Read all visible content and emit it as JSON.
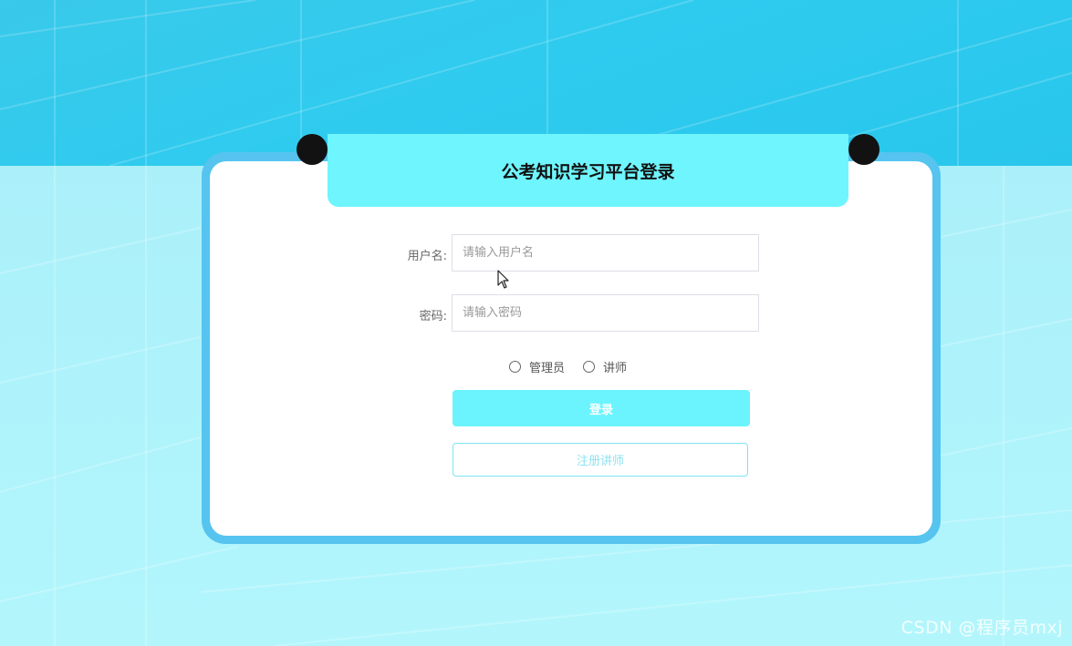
{
  "page": {
    "title": "公考知识学习平台登录",
    "watermark": "CSDN @程序员mxj"
  },
  "form": {
    "username": {
      "label": "用户名:",
      "placeholder": "请输入用户名",
      "value": ""
    },
    "password": {
      "label": "密码:",
      "placeholder": "请输入密码",
      "value": ""
    },
    "roles": [
      {
        "label": "管理员",
        "selected": false
      },
      {
        "label": "讲师",
        "selected": false
      }
    ],
    "login_label": "登录",
    "register_label": "注册讲师"
  },
  "colors": {
    "accent": "#6ff5fd",
    "frame": "#56c4ef",
    "background_top": "#2fcbef",
    "background_bottom": "#aef3fb"
  },
  "icons": {
    "cursor": "mouse-pointer-icon"
  }
}
